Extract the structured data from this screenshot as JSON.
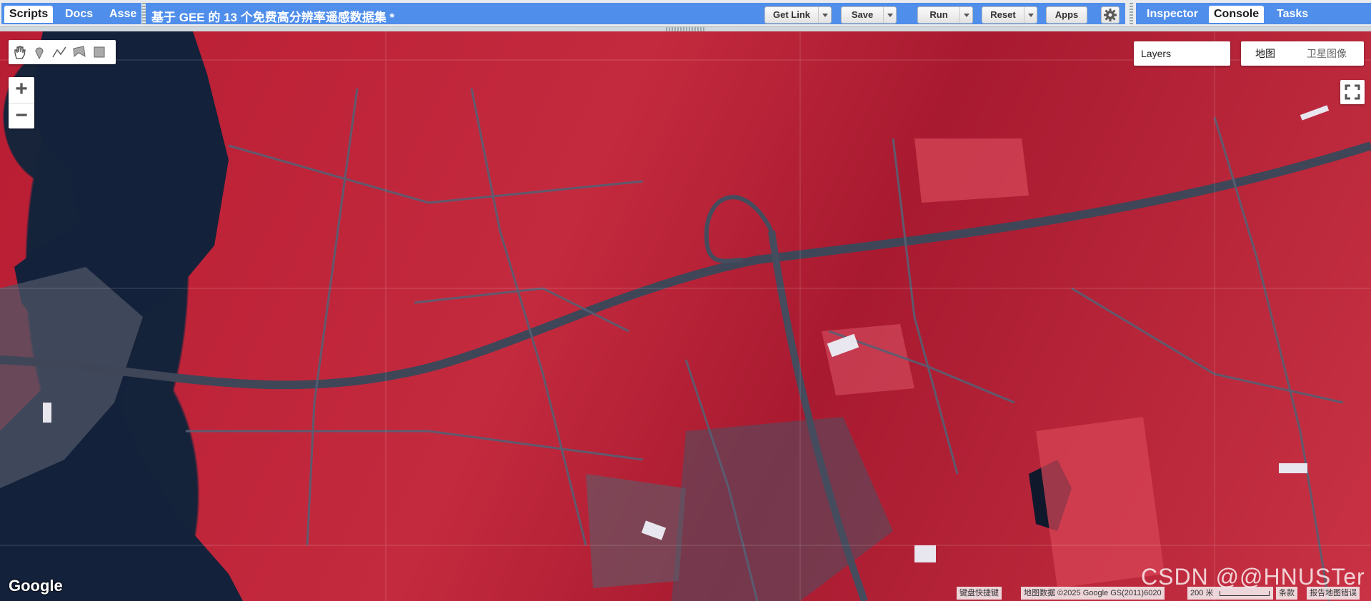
{
  "left_tabs": [
    {
      "label": "Scripts",
      "active": true
    },
    {
      "label": "Docs",
      "active": false
    },
    {
      "label": "Asse",
      "active": false
    }
  ],
  "doc_title": "基于 GEE 的 13 个免费高分辨率遥感数据集 *",
  "toolbar": {
    "get_link": "Get Link",
    "save": "Save",
    "run": "Run",
    "reset": "Reset",
    "apps": "Apps"
  },
  "right_tabs": [
    {
      "label": "Inspector",
      "active": false
    },
    {
      "label": "Console",
      "active": true
    },
    {
      "label": "Tasks",
      "active": false
    }
  ],
  "map": {
    "layers_label": "Layers",
    "map_type_options": [
      "地图",
      "卫星图像"
    ],
    "selected_map_type": "地图",
    "zoom_in": "+",
    "zoom_out": "−",
    "google_logo": "Google",
    "watermark": "CSDN @@HNUSTer",
    "footer": {
      "shortcuts": "键盘快捷键",
      "attribution": "地图数据 ©2025 Google GS(2011)6020",
      "scale": "200 米",
      "terms": "条款",
      "report": "报告地图错误"
    }
  },
  "colors": {
    "panel_blue": "#4f8eeb",
    "vegetation_red": "#c42a3e",
    "water": "#15233a"
  },
  "icons": [
    "hand-icon",
    "marker-icon",
    "line-icon",
    "polygon-icon",
    "rectangle-icon",
    "gear-icon",
    "fullscreen-icon"
  ]
}
